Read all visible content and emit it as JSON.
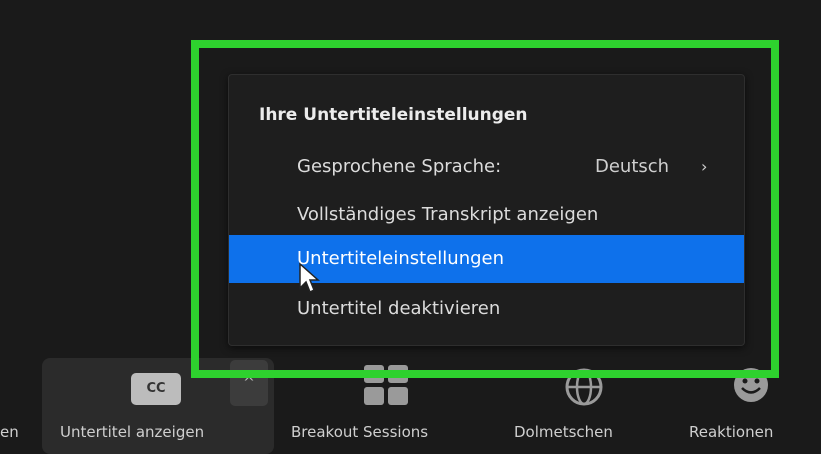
{
  "menu": {
    "title": "Ihre Untertiteleinstellungen",
    "items": [
      {
        "label": "Gesprochene Sprache:",
        "value": "Deutsch",
        "chevron": "›"
      },
      {
        "label": "Vollständiges Transkript anzeigen"
      },
      {
        "label": "Untertiteleinstellungen",
        "active": true
      },
      {
        "label": "Untertitel deaktivieren"
      }
    ]
  },
  "toolbar": {
    "partial_label": "en",
    "cc_icon_text": "CC",
    "caret": "^",
    "buttons": [
      {
        "label": "Untertitel anzeigen",
        "icon": "cc-icon"
      },
      {
        "label": "Breakout Sessions",
        "icon": "breakout-icon"
      },
      {
        "label": "Dolmetschen",
        "icon": "globe-icon"
      },
      {
        "label": "Reaktionen",
        "icon": "reaction-icon"
      }
    ]
  },
  "colors": {
    "highlight_border": "#2ed12e",
    "active_item": "#0e71eb",
    "background": "#1a1a1a"
  }
}
